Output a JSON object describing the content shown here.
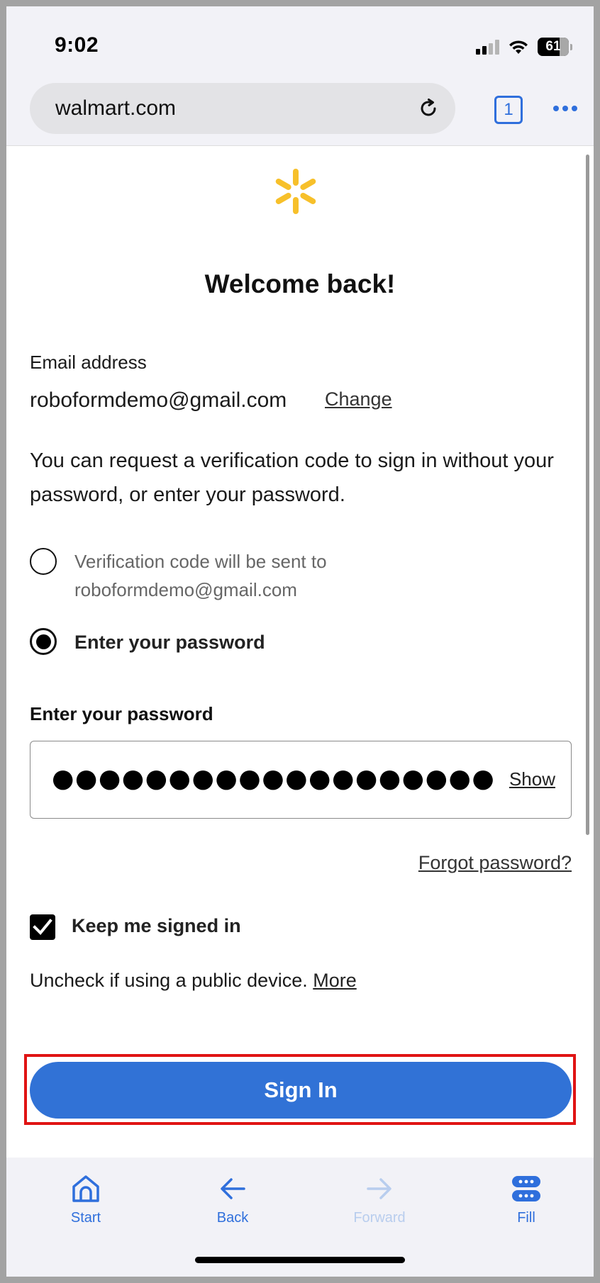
{
  "status_bar": {
    "time": "9:02",
    "battery": "61"
  },
  "browser": {
    "url": "walmart.com",
    "tab_count": "1"
  },
  "login": {
    "title": "Welcome back!",
    "email_label": "Email address",
    "email_value": "roboformdemo@gmail.com",
    "change_label": "Change",
    "info_text": "You can request a verification code to sign in without your password, or enter your password.",
    "option_code_line1": "Verification code will be sent to",
    "option_code_line2": "roboformdemo@gmail.com",
    "option_password_label": "Enter your password",
    "password_field_label": "Enter your password",
    "password_mask": "●●●●●●●●●●●●●●●●●●●",
    "show_label": "Show",
    "forgot_label": "Forgot password?",
    "keep_signed_in_label": "Keep me signed in",
    "uncheck_text": "Uncheck if using a public device.",
    "more_label": "More",
    "signin_label": "Sign In"
  },
  "toolbar": {
    "start": "Start",
    "back": "Back",
    "forward": "Forward",
    "fill": "Fill"
  },
  "colors": {
    "accent": "#2f6fdc",
    "button": "#3172d6",
    "highlight": "#e01414",
    "logo": "#f7c02a"
  }
}
